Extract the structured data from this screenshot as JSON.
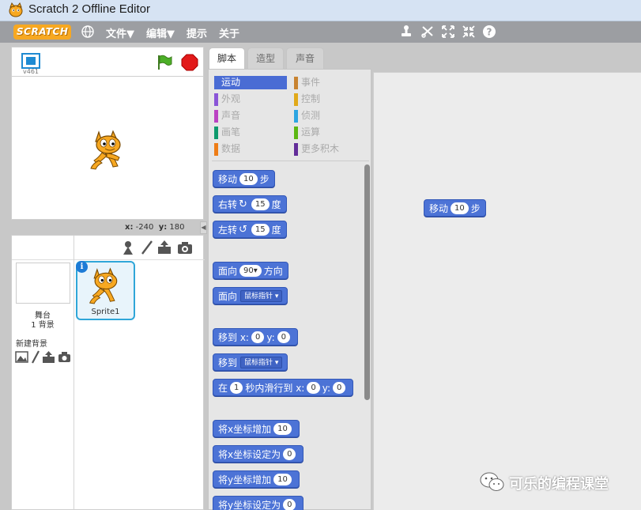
{
  "window": {
    "title": "Scratch 2 Offline Editor"
  },
  "menubar": {
    "logo": "SCRATCH",
    "items": [
      "文件▼",
      "编辑▼",
      "提示",
      "关于"
    ]
  },
  "stage": {
    "version": "v461",
    "coords_x_label": "x:",
    "coords_x": "-240",
    "coords_y_label": "y:",
    "coords_y": "180"
  },
  "sprites": {
    "stage_label": "舞台",
    "stage_backdrops": "1 背景",
    "new_backdrop": "新建背景",
    "sprite_name": "Sprite1"
  },
  "tabs": [
    "脚本",
    "造型",
    "声音"
  ],
  "categories": {
    "left": [
      "运动",
      "外观",
      "声音",
      "画笔",
      "数据"
    ],
    "right": [
      "事件",
      "控制",
      "侦测",
      "运算",
      "更多积木"
    ],
    "colors_left": [
      "#4a6cd4",
      "#8a55d7",
      "#bb42c3",
      "#0e9a6c",
      "#ee7d16"
    ],
    "colors_right": [
      "#c88330",
      "#e1a91a",
      "#2ca5e2",
      "#5cb712",
      "#632d99"
    ]
  },
  "blocks": {
    "move": {
      "label": "移动",
      "value": "10",
      "unit": "步"
    },
    "turn_right": {
      "label": "右转",
      "value": "15",
      "unit": "度"
    },
    "turn_left": {
      "label": "左转",
      "value": "15",
      "unit": "度"
    },
    "point_dir": {
      "label": "面向",
      "value": "90▾",
      "unit": "方向"
    },
    "point_toward": {
      "label": "面向",
      "dropdown": "鼠标指针 ▾"
    },
    "goto_xy": {
      "label": "移到 x:",
      "x": "0",
      "y_label": "y:",
      "y": "0"
    },
    "goto": {
      "label": "移到",
      "dropdown": "鼠标指针 ▾"
    },
    "glide": {
      "label": "在",
      "secs": "1",
      "mid": "秒内滑行到 x:",
      "x": "0",
      "y_label": "y:",
      "y": "0"
    },
    "change_x": {
      "label": "将x坐标增加",
      "value": "10"
    },
    "set_x": {
      "label": "将x坐标设定为",
      "value": "0"
    },
    "change_y": {
      "label": "将y坐标增加",
      "value": "10"
    },
    "set_y": {
      "label": "将y坐标设定为",
      "value": "0"
    }
  },
  "script": {
    "move": {
      "label": "移动",
      "value": "10",
      "unit": "步"
    }
  },
  "watermark": "可乐的编程课堂"
}
